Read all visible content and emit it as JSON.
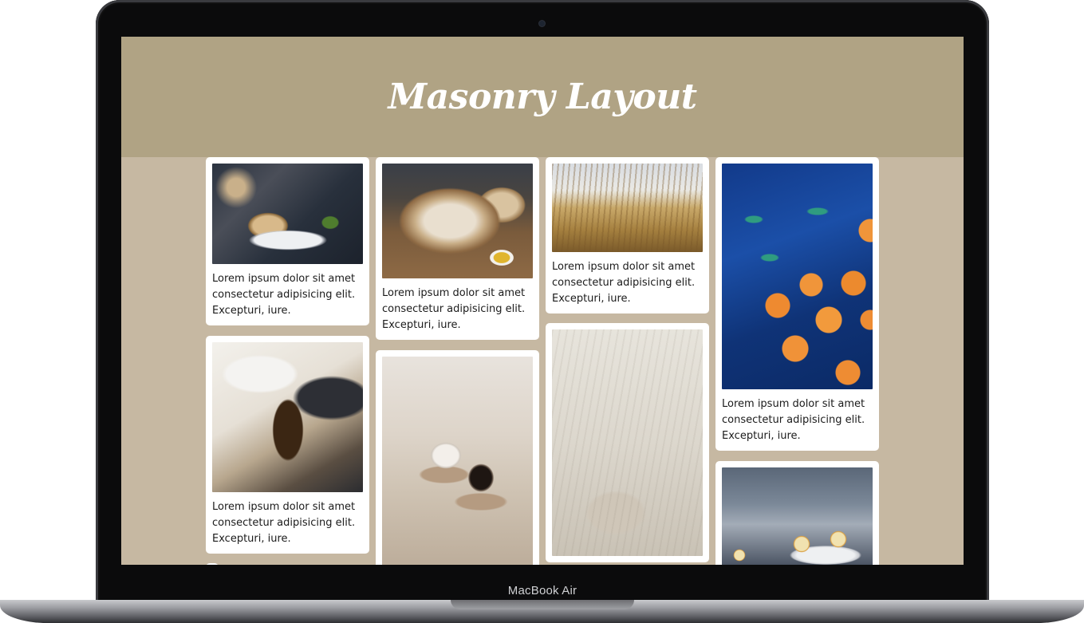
{
  "page": {
    "title": "Masonry Layout",
    "header_color": "#b0a384",
    "background_color": "#c6b8a2"
  },
  "device": {
    "label": "MacBook Air"
  },
  "cards": [
    {
      "image": "sandwich-plate-photo",
      "caption": "Lorem ipsum dolor sit amet consectetur adipisicing elit. Excepturi, iure."
    },
    {
      "image": "bread-olive-oil-photo",
      "caption": "Lorem ipsum dolor sit amet consectetur adipisicing elit. Excepturi, iure."
    },
    {
      "image": "wheat-field-photo",
      "caption": "Lorem ipsum dolor sit amet consectetur adipisicing elit. Excepturi, iure."
    },
    {
      "image": "oranges-blue-table-photo",
      "caption": "Lorem ipsum dolor sit amet consectetur adipisicing elit. Excepturi, iure."
    },
    {
      "image": "bottle-pouring-photo",
      "caption": "Lorem ipsum dolor sit amet consectetur adipisicing elit. Excepturi, iure."
    },
    {
      "image": "coffee-cups-photo",
      "caption": ""
    },
    {
      "image": "plant-shadow-photo",
      "caption": ""
    },
    {
      "image": "cupcakes-photo",
      "caption": ""
    }
  ]
}
